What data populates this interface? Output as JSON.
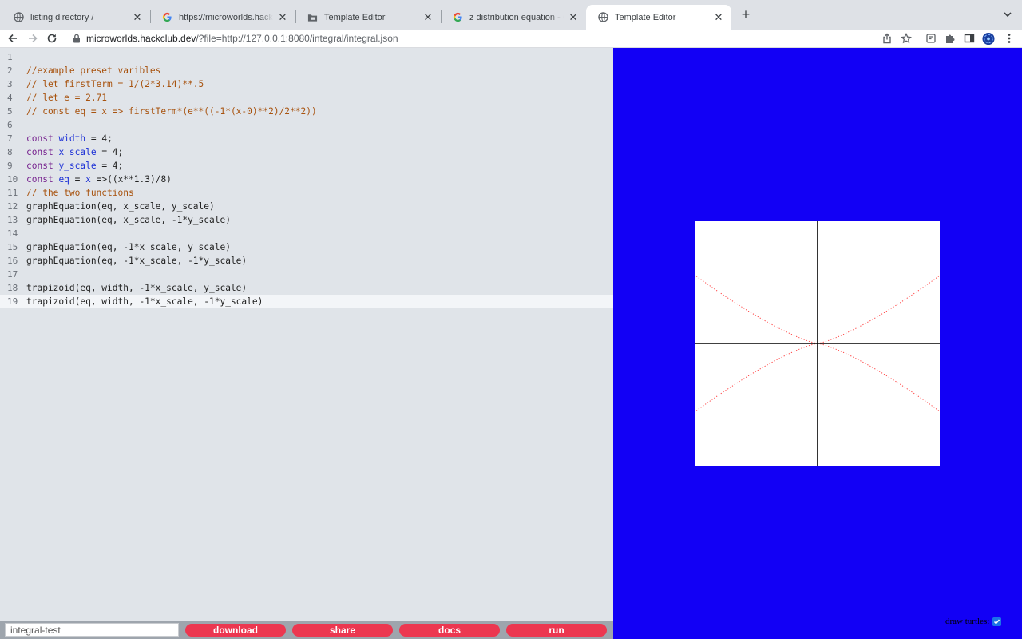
{
  "browser": {
    "tabs": [
      {
        "title": "listing directory /",
        "favicon": "globe-icon",
        "active": false
      },
      {
        "title": "https://microworlds.hackclub.dev",
        "favicon": "google-icon",
        "active": false
      },
      {
        "title": "Template Editor",
        "favicon": "folder-icon",
        "active": false
      },
      {
        "title": "z distribution equation - Google Search",
        "favicon": "google-icon",
        "active": false
      },
      {
        "title": "Template Editor",
        "favicon": "globe-icon",
        "active": true
      }
    ],
    "new_tab": "+",
    "url_host": "microworlds.hackclub.dev",
    "url_path": "/?file=http://127.0.0.1:8080/integral/integral.json"
  },
  "editor": {
    "active_line": 19,
    "line_numbers": [
      "1",
      "2",
      "3",
      "4",
      "5",
      "6",
      "7",
      "8",
      "9",
      "10",
      "11",
      "12",
      "13",
      "14",
      "15",
      "16",
      "17",
      "18",
      "19"
    ],
    "lines": [
      "",
      "//example preset varibles",
      "// let firstTerm = 1/(2*3.14)**.5",
      "// let e = 2.71",
      "// const eq = x => firstTerm*(e**((-1*(x-0)**2)/2**2))",
      "",
      "const width = 4;",
      "const x_scale = 4;",
      "const y_scale = 4;",
      "const eq = x =>((x**1.3)/8)",
      "// the two functions",
      "graphEquation(eq, x_scale, y_scale)",
      "graphEquation(eq, x_scale, -1*y_scale)",
      "",
      "graphEquation(eq, -1*x_scale, y_scale)",
      "graphEquation(eq, -1*x_scale, -1*y_scale)",
      "",
      "trapizoid(eq, width, -1*x_scale, y_scale)",
      "trapizoid(eq, width, -1*x_scale, -1*y_scale)"
    ]
  },
  "bottom_bar": {
    "name_value": "integral-test",
    "buttons": [
      "download",
      "share",
      "docs",
      "run"
    ]
  },
  "viewer": {
    "background": "#1200f5",
    "curve_color": "#ff4040",
    "draw_turtles_label": "draw turtles:",
    "draw_turtles_checked": true
  },
  "colors": {
    "accent": "#ec3750",
    "comment": "#a8530f",
    "keyword": "#77248f",
    "definition": "#1b2fd6"
  }
}
